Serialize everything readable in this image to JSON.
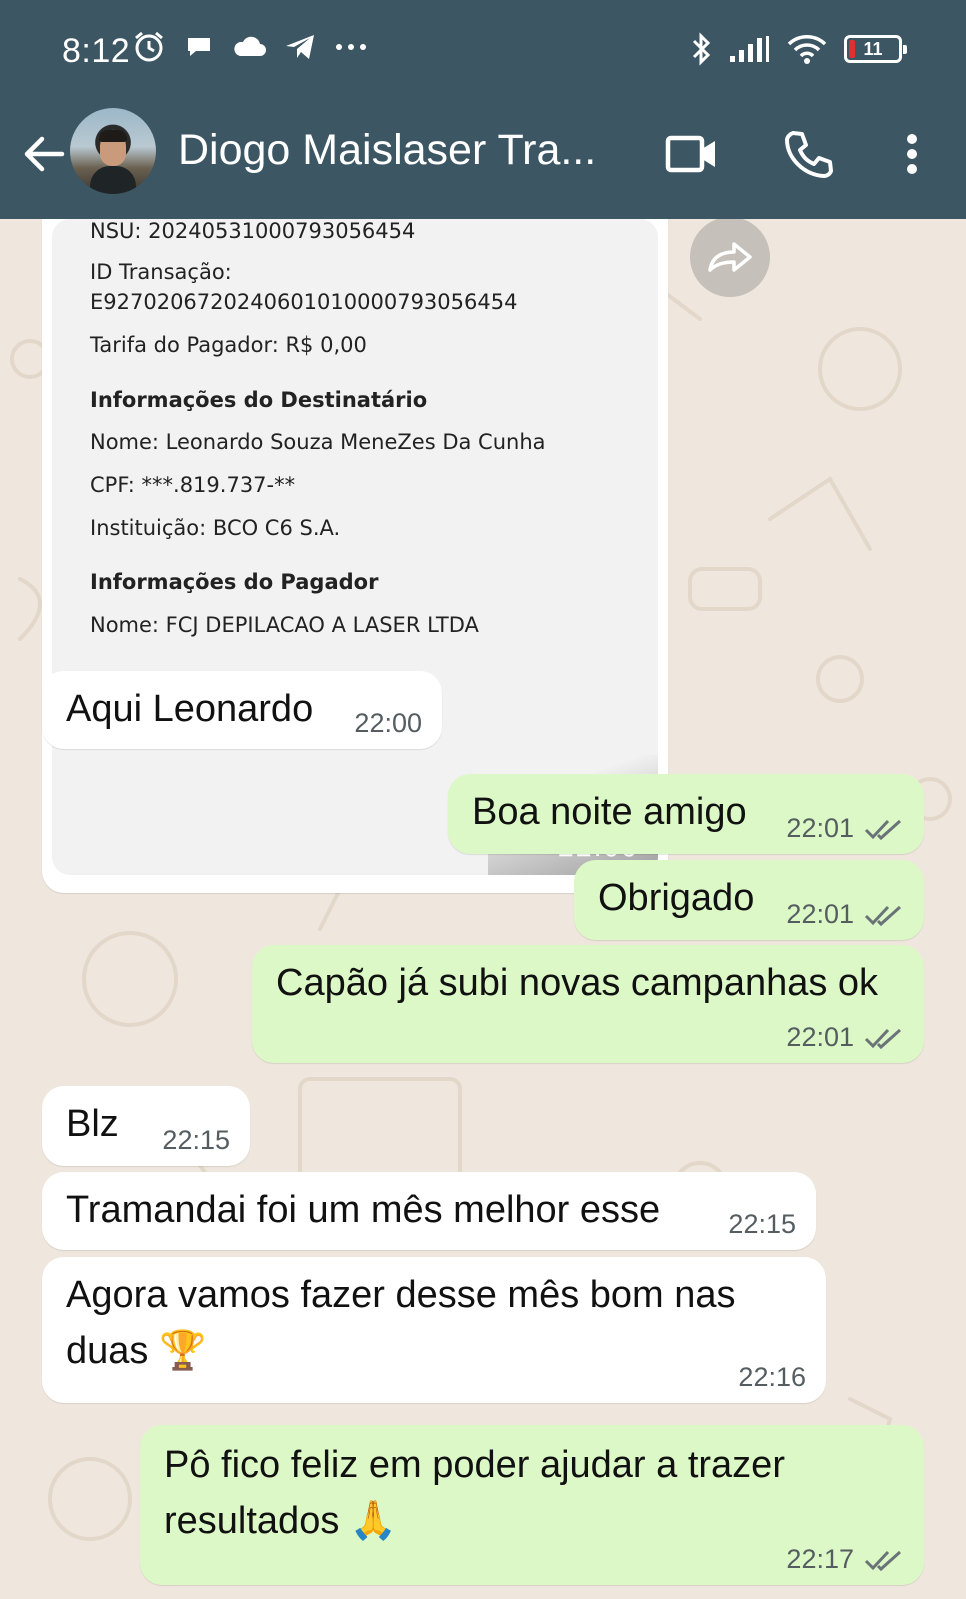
{
  "status_bar": {
    "time": "8:12",
    "battery": "11",
    "icons_left": [
      "alarm-icon",
      "chat-bubble-icon",
      "cloud-icon",
      "telegram-icon",
      "more-dots-icon"
    ],
    "icons_right": [
      "bluetooth-icon",
      "signal-icon",
      "wifi-icon",
      "battery-icon"
    ]
  },
  "header": {
    "contact_name": "Diogo Maislaser Tra...",
    "colors": {
      "bar": "#3c5663"
    }
  },
  "receipt": {
    "nsu": "NSU: 20240531000793056454",
    "id_label": "ID Transação:",
    "id_value": "E92702067202406010100007930564 54",
    "id_value_exact": "E9270206720240601010000793056454",
    "fee": "Tarifa do Pagador: R$ 0,00",
    "dest_heading": "Informações do Destinatário",
    "dest_name": "Nome: Leonardo Souza MeneZes Da Cunha",
    "dest_cpf": "CPF: ***.819.737-**",
    "dest_inst": "Instituição: BCO C6 S.A.",
    "payer_heading": "Informações do Pagador",
    "payer_name": "Nome: FCJ DEPILACAO A LASER LTDA",
    "time": "22:00"
  },
  "messages": [
    {
      "dir": "in",
      "text": "Aqui Leonardo",
      "time": "22:00"
    },
    {
      "dir": "out",
      "text": "Boa noite amigo",
      "time": "22:01"
    },
    {
      "dir": "out",
      "text": "Obrigado",
      "time": "22:01"
    },
    {
      "dir": "out",
      "text": "Capão já subi novas campanhas ok",
      "time": "22:01"
    },
    {
      "dir": "in",
      "text": "Blz",
      "time": "22:15"
    },
    {
      "dir": "in",
      "text": "Tramandai foi um mês melhor esse",
      "time": "22:15"
    },
    {
      "dir": "in",
      "text_line1": "Agora vamos fazer desse mês bom nas",
      "text_line2": "duas 🏆",
      "time": "22:16"
    },
    {
      "dir": "out",
      "text_line1": "Pô fico feliz em poder ajudar a trazer",
      "text_line2": "resultados 🙏",
      "time": "22:17"
    }
  ]
}
